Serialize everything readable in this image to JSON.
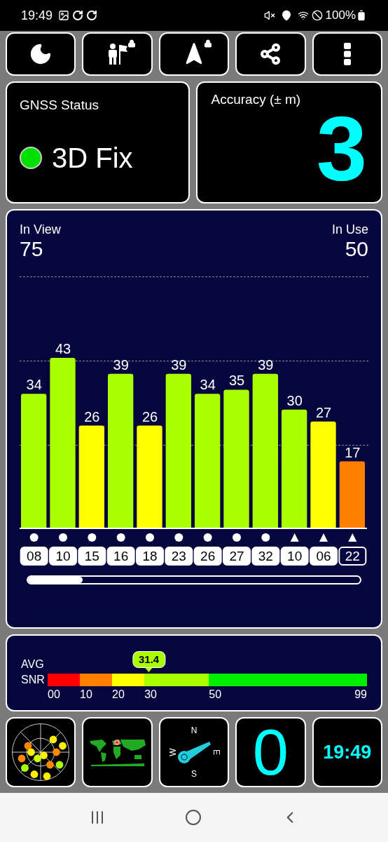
{
  "status_bar": {
    "time": "19:49",
    "battery": "100%"
  },
  "toolbar": [
    {
      "kind": "moon",
      "locked": false
    },
    {
      "kind": "person-flag",
      "locked": true
    },
    {
      "kind": "arrow",
      "locked": true
    },
    {
      "kind": "share",
      "locked": false
    },
    {
      "kind": "more",
      "locked": false
    }
  ],
  "gnss_status": {
    "title": "GNSS Status",
    "value": "3D Fix",
    "color": "#00e000"
  },
  "accuracy": {
    "title": "Accuracy (± m)",
    "value": "3"
  },
  "satellites_panel": {
    "in_view_label": "In View",
    "in_view": "75",
    "in_use_label": "In Use",
    "in_use": "50",
    "chart_data": {
      "type": "bar",
      "categories": [
        "08",
        "10",
        "15",
        "16",
        "18",
        "23",
        "26",
        "27",
        "32",
        "10",
        "06",
        "22"
      ],
      "data_labels": true,
      "series": [
        {
          "values": [
            34,
            43,
            26,
            39,
            26,
            39,
            34,
            35,
            39,
            30,
            27,
            17
          ]
        }
      ]
    },
    "satellites": [
      {
        "kind": "circle",
        "used": true
      },
      {
        "kind": "circle",
        "used": true
      },
      {
        "kind": "circle",
        "used": true
      },
      {
        "kind": "circle",
        "used": true
      },
      {
        "kind": "circle",
        "used": true
      },
      {
        "kind": "circle",
        "used": true
      },
      {
        "kind": "circle",
        "used": true
      },
      {
        "kind": "circle",
        "used": true
      },
      {
        "kind": "circle",
        "used": true
      },
      {
        "kind": "triangle",
        "used": true
      },
      {
        "kind": "triangle",
        "used": true
      },
      {
        "kind": "triangle",
        "used": false
      }
    ]
  },
  "snr_panel": {
    "label_1": "AVG",
    "label_2": "SNR",
    "average": "31.4",
    "segments": [
      {
        "label": "00",
        "color": "#ff0000"
      },
      {
        "label": "10",
        "color": "#ff7f00"
      },
      {
        "label": "20",
        "color": "#ffff00"
      },
      {
        "label": "30",
        "color": "#aaff00"
      },
      {
        "label": "50",
        "color": "#00ee00"
      }
    ],
    "end_label": "99"
  },
  "tiles": [
    {
      "kind": "skyplot"
    },
    {
      "kind": "map"
    },
    {
      "kind": "compass",
      "north": "N",
      "east": "E",
      "south": "S",
      "west": "W"
    },
    {
      "kind": "number",
      "value": "0"
    },
    {
      "kind": "clock",
      "value": "19:49"
    }
  ]
}
